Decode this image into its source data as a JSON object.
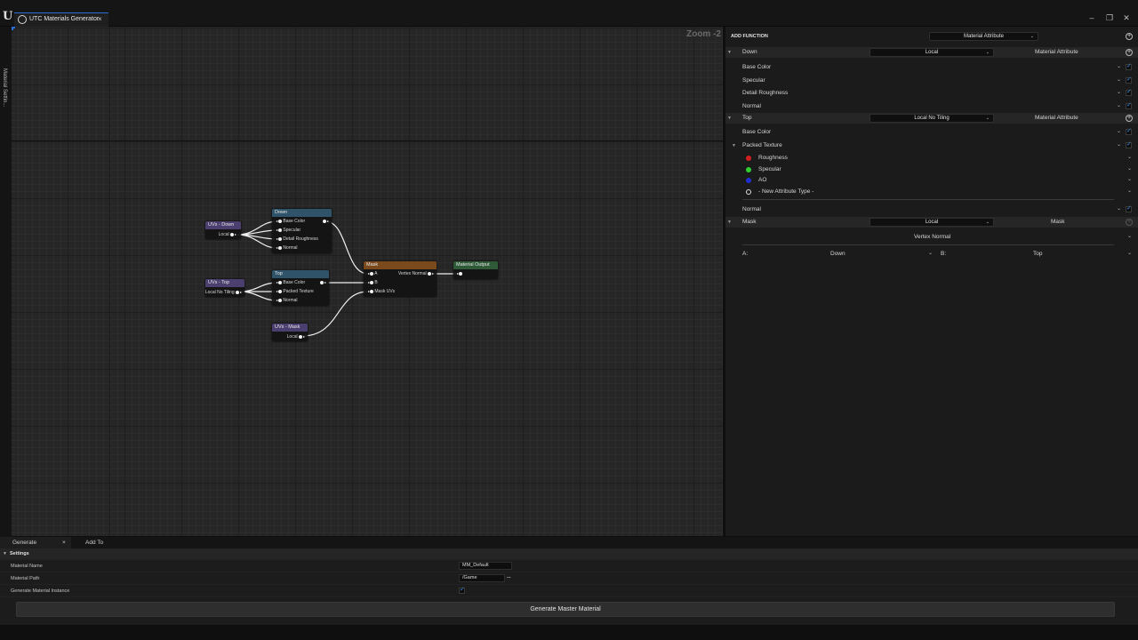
{
  "window": {
    "tab_title": "UTC Materials Generator",
    "close_glyph": "×",
    "controls": {
      "minimize": "–",
      "maximize": "❐",
      "close": "✕"
    },
    "left_strip_label": "Material Settin..."
  },
  "graph": {
    "zoom_label": "Zoom -2",
    "nodes": {
      "uvs_down": {
        "title": "UVs - Down",
        "output": "Local"
      },
      "down": {
        "title": "Down",
        "pins": [
          "Base Color",
          "Specular",
          "Detail Roughness",
          "Normal"
        ]
      },
      "uvs_top": {
        "title": "UVs - Top",
        "output": "Local No Tiling"
      },
      "top": {
        "title": "Top",
        "pins": [
          "Base Color",
          "Packed Texture",
          "Normal"
        ]
      },
      "uvs_mask": {
        "title": "UVs - Mask",
        "output": "Local"
      },
      "mask": {
        "title": "Mask",
        "inputs": [
          "A",
          "B",
          "Mask UVs"
        ],
        "output": "Vertex Normal"
      },
      "material_output": {
        "title": "Material Output"
      }
    },
    "colors": {
      "uvs_header": "#4a3f6e",
      "function_header": "#2f5368",
      "mask_header": "#7a4a1c",
      "output_header": "#2f5a37",
      "wire": "#f0f0f0"
    }
  },
  "panel": {
    "add_function_label": "ADD FUNCTION",
    "add_function_type": "Material Attribute",
    "down": {
      "name": "Down",
      "uv": "Local",
      "type": "Material Attribute",
      "attributes": [
        "Base Color",
        "Specular",
        "Detail Roughness",
        "Normal"
      ]
    },
    "top": {
      "name": "Top",
      "uv": "Local No Tiling",
      "type": "Material Attribute",
      "base_color": "Base Color",
      "packed": "Packed Texture",
      "channels": [
        {
          "name": "Roughness",
          "color": "#d42020"
        },
        {
          "name": "Specular",
          "color": "#2fcf2f"
        },
        {
          "name": "AO",
          "color": "#2030d0"
        },
        {
          "name": "- New Attribute Type -",
          "color": ""
        }
      ],
      "normal": "Normal"
    },
    "mask": {
      "name": "Mask",
      "uv": "Local",
      "type": "Mask",
      "source": "Vertex Normal",
      "a_label": "A:",
      "a_value": "Down",
      "b_label": "B:",
      "b_value": "Top"
    }
  },
  "bottom": {
    "tabs": [
      "Generate",
      "Add To"
    ],
    "tab_close": "×",
    "settings_label": "Settings",
    "rows": {
      "material_name_label": "Material Name",
      "material_name_value": "MM_Default",
      "material_path_label": "Material Path",
      "material_path_value": "/Game",
      "browse": "...",
      "instance_label": "Generate Material Instance"
    },
    "generate_button": "Generate Master Material"
  }
}
